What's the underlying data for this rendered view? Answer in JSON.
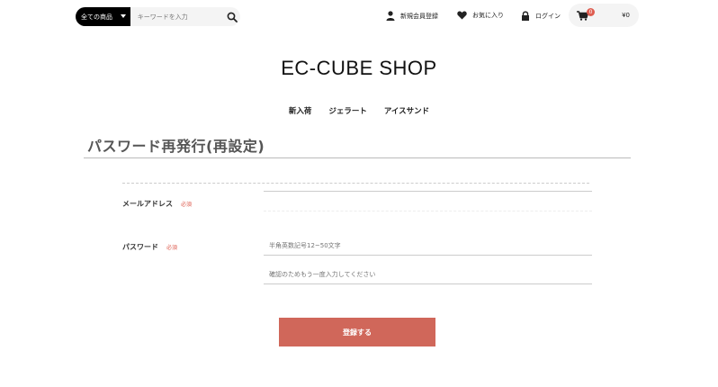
{
  "header": {
    "category_select": "全ての商品",
    "search_placeholder": "キーワードを入力",
    "nav": {
      "register": "新規会員登録",
      "favorites": "お気に入り",
      "login": "ログイン"
    },
    "cart": {
      "count": "0",
      "total": "¥0"
    }
  },
  "logo": "EC-CUBE SHOP",
  "categories": [
    "新入荷",
    "ジェラート",
    "アイスサンド"
  ],
  "page_title": "パスワード再発行(再設定)",
  "form": {
    "email_label": "メールアドレス",
    "email_required": "必須",
    "password_label": "パスワード",
    "password_required": "必須",
    "password_placeholder": "半角英数記号12~50文字",
    "password_confirm_placeholder": "確認のためもう一度入力してください",
    "submit_label": "登録する"
  },
  "colors": {
    "accent": "#de5d50",
    "button": "#d0675a"
  }
}
